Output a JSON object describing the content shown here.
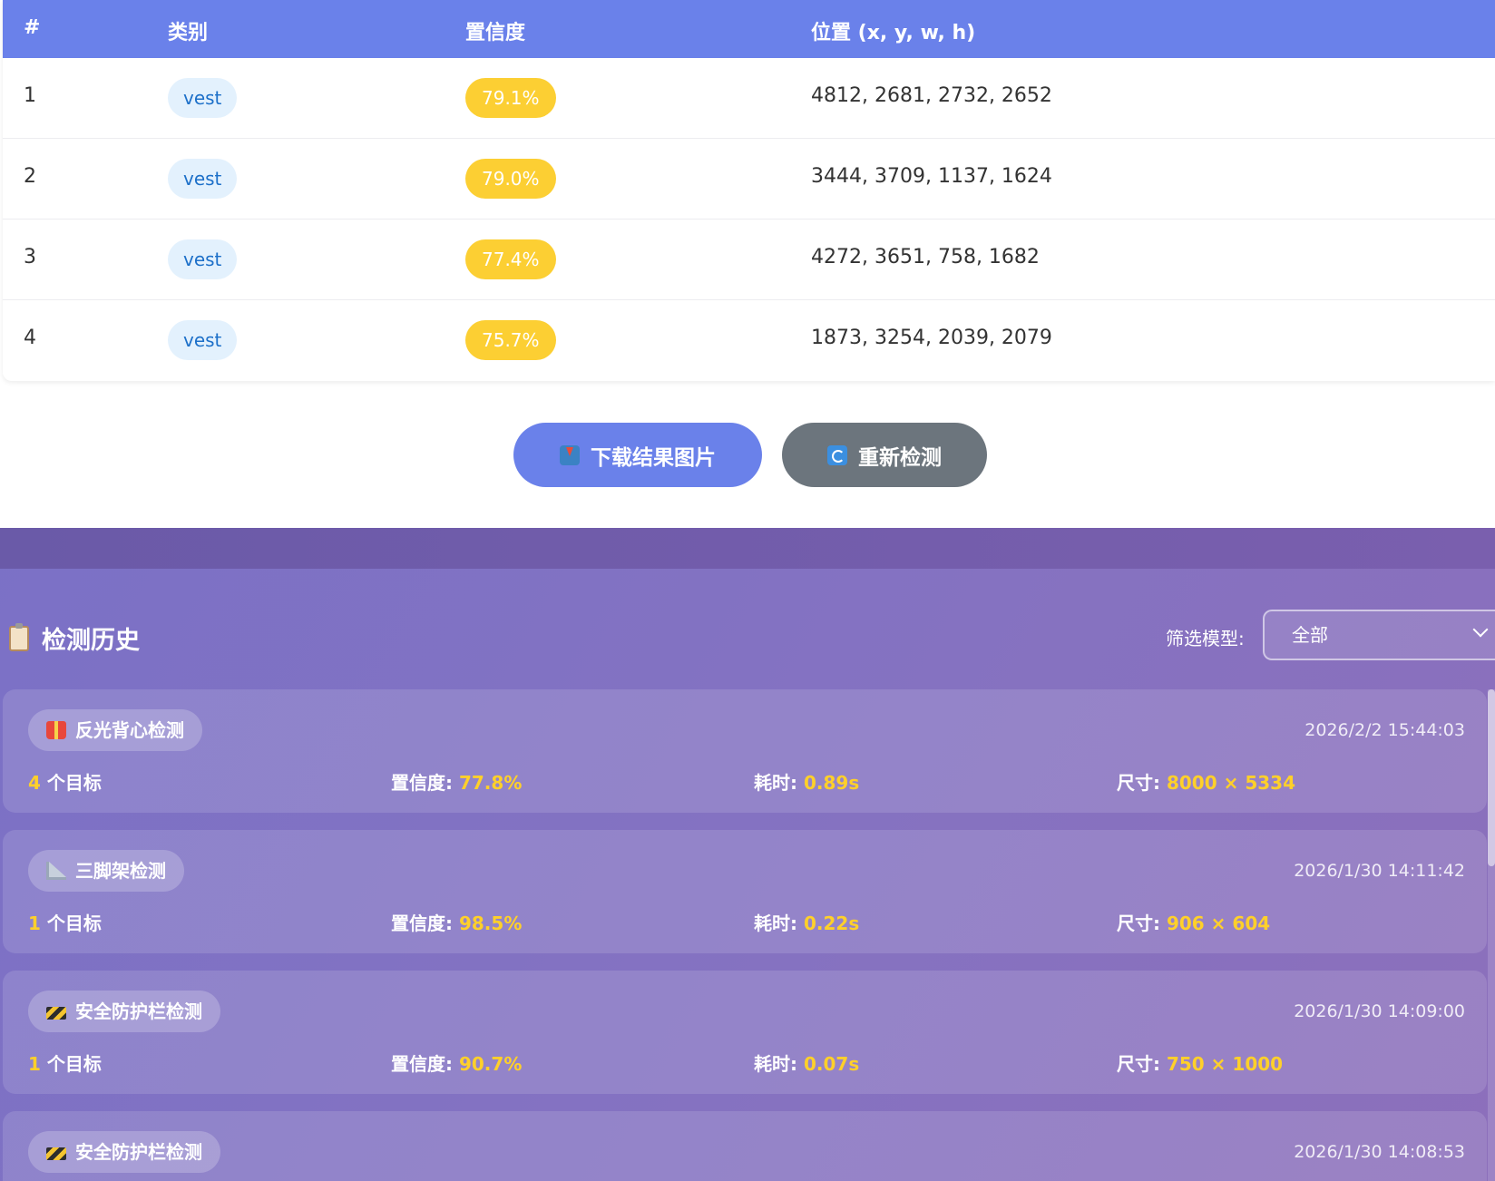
{
  "table": {
    "headers": {
      "idx": "#",
      "class": "类别",
      "confidence": "置信度",
      "position": "位置 (x, y, w, h)"
    },
    "rows": [
      {
        "idx": "1",
        "class": "vest",
        "confidence": "79.1%",
        "position": "4812, 2681, 2732, 2652"
      },
      {
        "idx": "2",
        "class": "vest",
        "confidence": "79.0%",
        "position": "3444, 3709, 1137, 1624"
      },
      {
        "idx": "3",
        "class": "vest",
        "confidence": "77.4%",
        "position": "4272, 3651, 758, 1682"
      },
      {
        "idx": "4",
        "class": "vest",
        "confidence": "75.7%",
        "position": "1873, 3254, 2039, 2079"
      }
    ]
  },
  "actions": {
    "download_label": "下载结果图片",
    "redetect_label": "重新检测"
  },
  "history": {
    "title": "检测历史",
    "filter_label": "筛选模型:",
    "filter_value": "全部",
    "items": [
      {
        "model": "反光背心检测",
        "icon": "vest-icon",
        "time": "2026/2/2 15:44:03",
        "count": "4",
        "count_suffix": " 个目标",
        "conf_label": "置信度: ",
        "conf": "77.8%",
        "dur_label": "耗时: ",
        "dur": "0.89s",
        "size_label": "尺寸: ",
        "size": "8000 × 5334"
      },
      {
        "model": "三脚架检测",
        "icon": "triangle-ruler-icon",
        "time": "2026/1/30 14:11:42",
        "count": "1",
        "count_suffix": " 个目标",
        "conf_label": "置信度: ",
        "conf": "98.5%",
        "dur_label": "耗时: ",
        "dur": "0.22s",
        "size_label": "尺寸: ",
        "size": "906 × 604"
      },
      {
        "model": "安全防护栏检测",
        "icon": "barrier-icon",
        "time": "2026/1/30 14:09:00",
        "count": "1",
        "count_suffix": " 个目标",
        "conf_label": "置信度: ",
        "conf": "90.7%",
        "dur_label": "耗时: ",
        "dur": "0.07s",
        "size_label": "尺寸: ",
        "size": "750 × 1000"
      },
      {
        "model": "安全防护栏检测",
        "icon": "barrier-icon",
        "time": "2026/1/30 14:08:53"
      }
    ]
  },
  "colors": {
    "primary": "#6a81ea",
    "secondary": "#6c757d",
    "badge_conf": "#fccf33",
    "highlight": "#ffd02a"
  }
}
